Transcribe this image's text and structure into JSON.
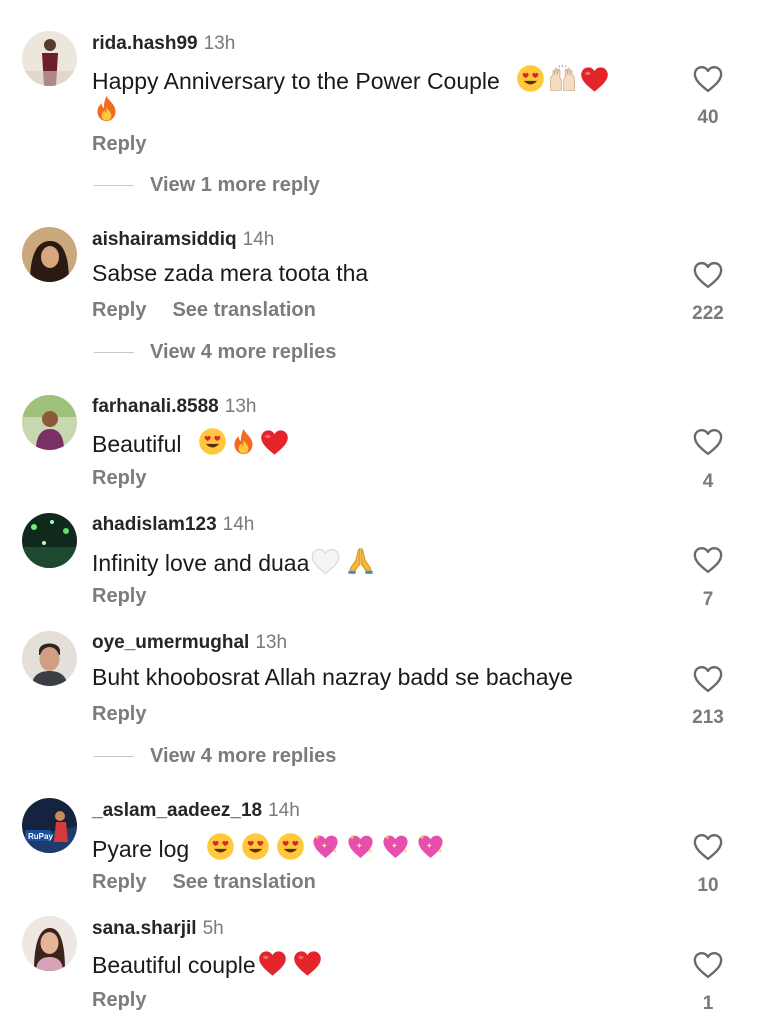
{
  "comments": [
    {
      "username": "rida.hash99",
      "time": "13h",
      "text": "Happy Anniversary to the Power Couple",
      "emojis_line1": [
        "heart-eyes",
        "raised-hands",
        "red-heart"
      ],
      "emojis_line2": [
        "fire"
      ],
      "reply": "Reply",
      "likes": "40",
      "view_more": "View 1 more reply"
    },
    {
      "username": "aishairamsiddiq",
      "time": "14h",
      "text": "Sabse zada mera toota tha",
      "reply": "Reply",
      "translate": "See translation",
      "likes": "222",
      "view_more": "View 4 more replies"
    },
    {
      "username": "farhanali.8588",
      "time": "13h",
      "text": "Beautiful",
      "emojis_line1": [
        "heart-eyes",
        "fire",
        "red-heart"
      ],
      "reply": "Reply",
      "likes": "4"
    },
    {
      "username": "ahadislam123",
      "time": "14h",
      "text": "Infinity love and duaa",
      "emojis_line1": [
        "white-heart",
        "folded-hands"
      ],
      "reply": "Reply",
      "likes": "7"
    },
    {
      "username": "oye_umermughal",
      "time": "13h",
      "text": "Buht khoobosrat Allah nazray badd se bachaye",
      "reply": "Reply",
      "likes": "213",
      "view_more": "View 4 more replies"
    },
    {
      "username": "_aslam_aadeez_18",
      "time": "14h",
      "text": "Pyare log",
      "emojis_line1": [
        "heart-eyes",
        "heart-eyes",
        "heart-eyes",
        "sparkling-heart",
        "sparkling-heart",
        "sparkling-heart",
        "sparkling-heart"
      ],
      "reply": "Reply",
      "translate": "See translation",
      "likes": "10"
    },
    {
      "username": "sana.sharjil",
      "time": "5h",
      "text": "Beautiful couple",
      "emojis_line1": [
        "red-heart",
        "red-heart"
      ],
      "reply": "Reply",
      "likes": "1"
    }
  ],
  "avatar_logo_text": "RuPay",
  "colors": {
    "secondary_text": "#7c7c7c",
    "heart_red": "#e3242b",
    "emoji_yellow": "#ffc83d"
  }
}
